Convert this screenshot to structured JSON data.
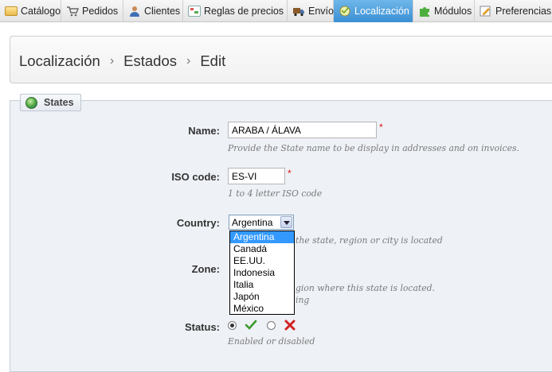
{
  "menu": {
    "tabs": [
      {
        "label": "Catálogo",
        "icon": "folder-icon"
      },
      {
        "label": "Pedidos",
        "icon": "cart-icon"
      },
      {
        "label": "Clientes",
        "icon": "user-icon"
      },
      {
        "label": "Reglas de precios",
        "icon": "price-rules-icon"
      },
      {
        "label": "Envío",
        "icon": "truck-icon"
      },
      {
        "label": "Localización",
        "icon": "localization-icon"
      },
      {
        "label": "Módulos",
        "icon": "puzzle-icon"
      },
      {
        "label": "Preferencias",
        "icon": "preferences-icon"
      }
    ],
    "active_tab": "Localización",
    "active_color": "#3a8fd3"
  },
  "breadcrumb": {
    "items": [
      "Localización",
      "Estados",
      "Edit"
    ]
  },
  "form": {
    "legend": "States",
    "name": {
      "label": "Name:",
      "value": "ARABA / ÁLAVA",
      "required_mark": "*",
      "hint": "Provide the State name to be display in addresses and on invoices."
    },
    "iso": {
      "label": "ISO code:",
      "value": "ES-VI",
      "required_mark": "*",
      "hint": "1 to 4 letter ISO code"
    },
    "country": {
      "label": "Country:",
      "selected": "Argentina",
      "options": [
        "Argentina",
        "Canadá",
        "EE.UU.",
        "Indonesia",
        "Italia",
        "Japón",
        "México"
      ],
      "hint_visible": "the state, region or city is located"
    },
    "zone": {
      "label": "Zone:",
      "hint_visible_1": "gion where this state is located.",
      "hint_visible_2": "ing"
    },
    "status": {
      "label": "Status:",
      "enabled_selected": true,
      "hint": "Enabled or disabled"
    }
  },
  "colors": {
    "panel_bg": "#eef1f6",
    "required": "#dd1111",
    "check": "#3c9a2e",
    "cross": "#d22222",
    "selected_option": "#3399ff"
  }
}
